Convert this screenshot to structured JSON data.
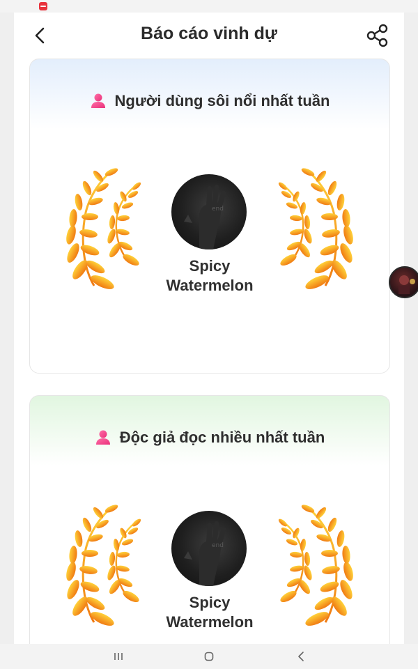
{
  "header": {
    "title": "Báo cáo vinh dự",
    "back_icon": "chevron-left-icon",
    "share_icon": "share-icon"
  },
  "cards": [
    {
      "heading": "Người dùng sôi nổi nhất tuần",
      "heading_icon": "user-icon",
      "user_name": "Spicy Watermelon",
      "background_accent": "#e3eefc"
    },
    {
      "heading": "Độc giả đọc nhiều nhất tuần",
      "heading_icon": "user-icon",
      "user_name": "Spicy Watermelon",
      "background_accent": "#e1f6e0"
    }
  ],
  "colors": {
    "heading_icon": "#f0408a",
    "wreath_top": "#ffd23a",
    "wreath_bottom": "#f07a12"
  },
  "nav": {
    "recent_icon": "recent-apps-icon",
    "home_icon": "home-icon",
    "back_icon": "nav-back-icon"
  }
}
